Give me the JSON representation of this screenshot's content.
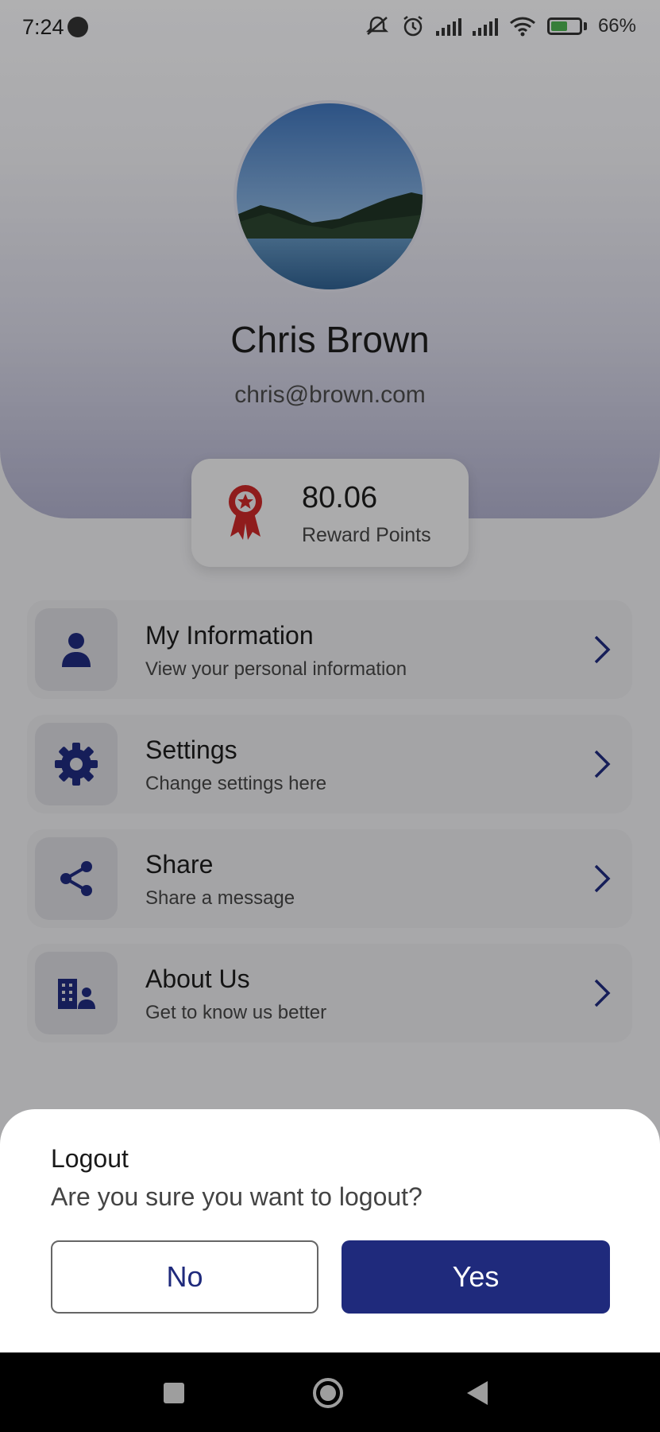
{
  "status_bar": {
    "time": "7:24",
    "battery_text": "66%"
  },
  "profile": {
    "name": "Chris Brown",
    "email": "chris@brown.com"
  },
  "reward": {
    "value": "80.06",
    "label": "Reward Points"
  },
  "menu": {
    "items": [
      {
        "title": "My Information",
        "subtitle": "View your personal information",
        "icon": "person-icon"
      },
      {
        "title": "Settings",
        "subtitle": "Change settings here",
        "icon": "gear-icon"
      },
      {
        "title": "Share",
        "subtitle": "Share a message",
        "icon": "share-icon"
      },
      {
        "title": "About Us",
        "subtitle": "Get to know us better",
        "icon": "company-icon"
      }
    ]
  },
  "logout_dialog": {
    "title": "Logout",
    "message": "Are you sure you want to logout?",
    "no_label": "No",
    "yes_label": "Yes"
  },
  "colors": {
    "accent": "#1f2a7c",
    "reward_icon": "#c62828"
  }
}
